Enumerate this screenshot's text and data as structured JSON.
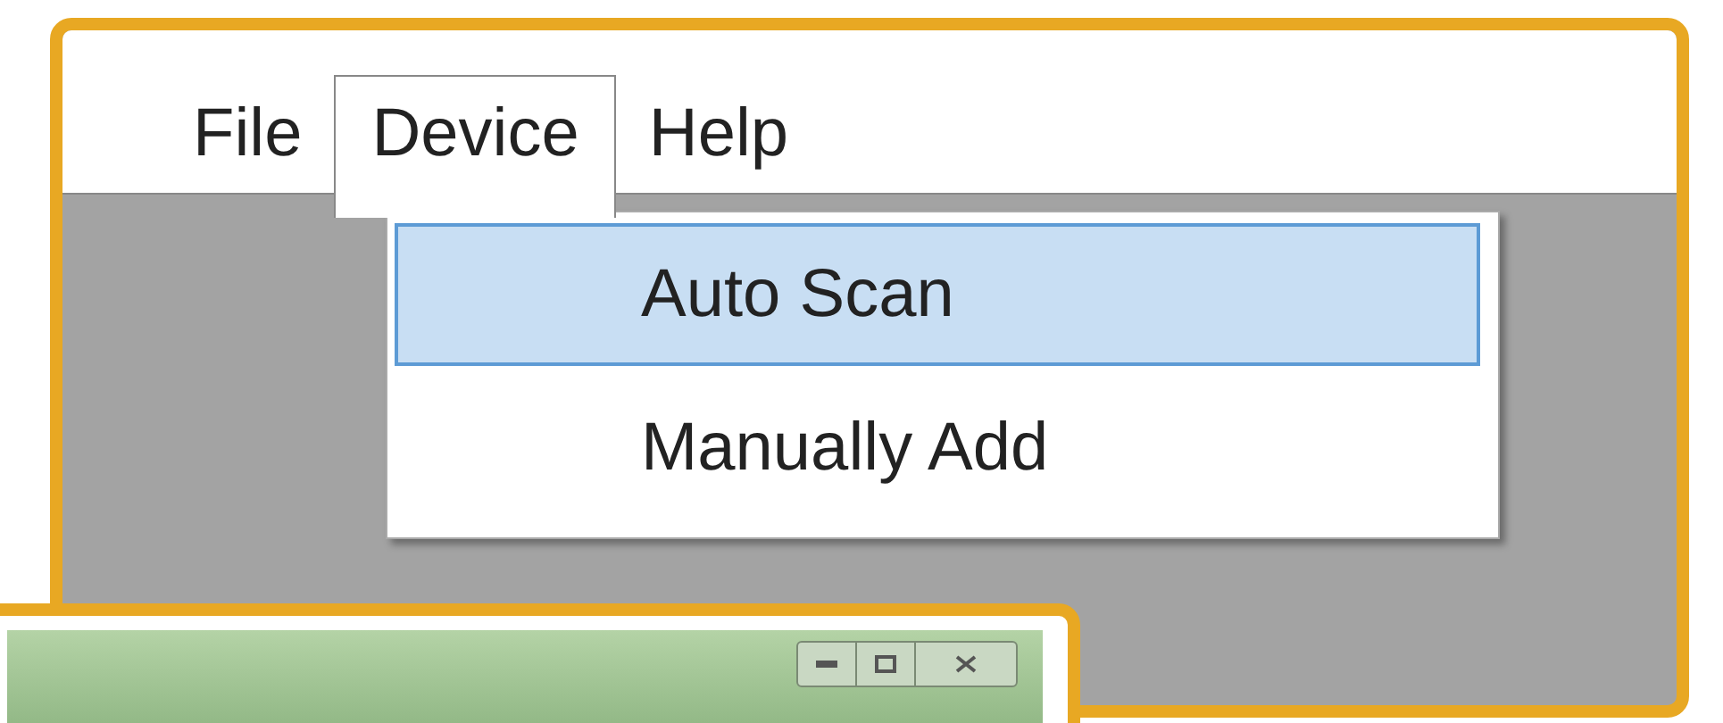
{
  "menu_bar": {
    "items": [
      {
        "label": "File",
        "selected": false
      },
      {
        "label": "Device",
        "selected": true
      },
      {
        "label": "Help",
        "selected": false
      }
    ]
  },
  "dropdown": {
    "items": [
      {
        "label": "Auto Scan",
        "selected": true
      },
      {
        "label": "Manually Add",
        "selected": false
      }
    ]
  }
}
